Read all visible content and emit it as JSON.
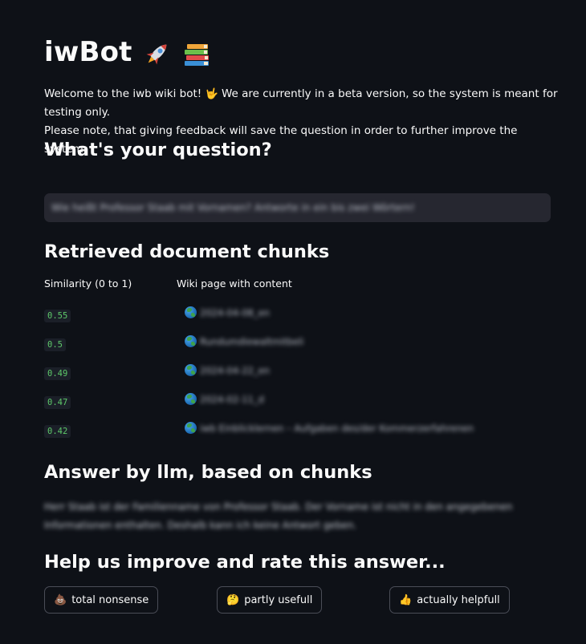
{
  "header": {
    "title": "iwBot",
    "title_icons": [
      "rocket-icon",
      "books-icon"
    ]
  },
  "intro": {
    "line1_a": "Welcome to the iwb wiki bot! ",
    "line1_b": " We are currently in a beta version, so the system is meant for testing only.",
    "line2": "Please note, that giving feedback will save the question in order to further improve the system.",
    "hand_icon": "rock-on-hand-icon"
  },
  "question_section": {
    "heading": "What's your question?",
    "value": "Wie heißt Professor Staab mit Vornamen? Antworte in ein bis zwei Wörtern!"
  },
  "chunks_section": {
    "heading": "Retrieved document chunks",
    "col_similarity": "Similarity (0 to 1)",
    "col_wiki": "Wiki page with content",
    "rows": [
      {
        "similarity": "0.55",
        "page": "2024-04-08_en"
      },
      {
        "similarity": "0.5",
        "page": "Rundumdiewaltmitbeli"
      },
      {
        "similarity": "0.49",
        "page": "2024-04-22_en"
      },
      {
        "similarity": "0.47",
        "page": "2024-02-11_d"
      },
      {
        "similarity": "0.42",
        "page": "iwb Einblicklernen – Aufgaben des/der Kommerzerfahrenen"
      }
    ]
  },
  "answer_section": {
    "heading": "Answer by llm, based on chunks",
    "line1": "Herr Staab ist der Familienname von Professor Staab. Der Vorname ist nicht in den angegebenen",
    "line2": "Informationen enthalten. Deshalb kann ich keine Antwort geben."
  },
  "rating_section": {
    "heading": "Help us improve and rate this answer...",
    "buttons": [
      {
        "icon": "poop-icon",
        "label": "total nonsense"
      },
      {
        "icon": "thinking-face-icon",
        "label": "partly usefull"
      },
      {
        "icon": "thumbs-up-icon",
        "label": "actually helpfull"
      }
    ]
  },
  "colors": {
    "background": "#0e1117",
    "input_background": "#262730",
    "similarity_text": "#5ec96a",
    "text": "#fafafa"
  }
}
